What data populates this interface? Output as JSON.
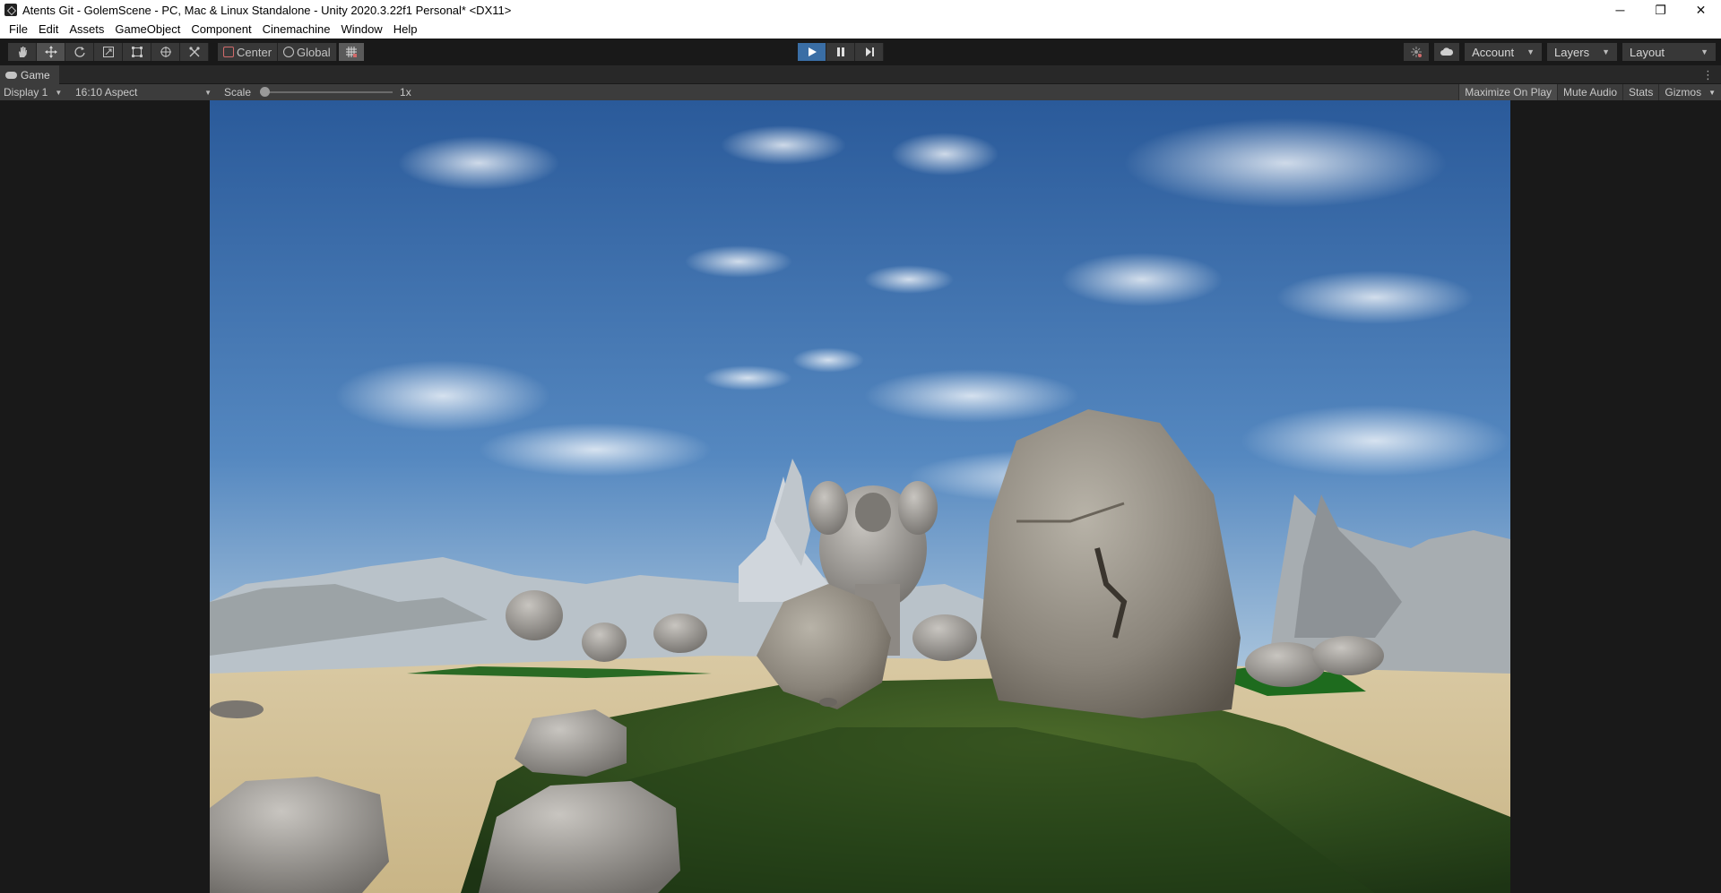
{
  "window": {
    "title": "Atents Git - GolemScene - PC, Mac & Linux Standalone - Unity 2020.3.22f1 Personal* <DX11>",
    "controls": [
      "─",
      "❐",
      "✕"
    ]
  },
  "menu": [
    "File",
    "Edit",
    "Assets",
    "GameObject",
    "Component",
    "Cinemachine",
    "Window",
    "Help"
  ],
  "toolbar": {
    "tools": [
      "hand-tool-icon",
      "move-tool-icon",
      "rotate-tool-icon",
      "scale-tool-icon",
      "rect-tool-icon",
      "transform-tool-icon",
      "custom-tool-icon"
    ],
    "active_tool": "move-tool-icon",
    "pivot_mode": "Center",
    "pivot_rotation": "Global",
    "play_active": true,
    "account_label": "Account",
    "layers_label": "Layers",
    "layout_label": "Layout"
  },
  "game_tab": {
    "label": "Game"
  },
  "game_bar": {
    "display": "Display 1",
    "aspect": "16:10 Aspect",
    "scale_label": "Scale",
    "scale_value": "1x",
    "scale_fraction": 0,
    "maximize_on_play": "Maximize On Play",
    "mute_audio": "Mute Audio",
    "stats": "Stats",
    "gizmos": "Gizmos"
  },
  "colors": {
    "play_accent": "#3a6ea5",
    "editor_bg": "#191919",
    "panel_bg": "#3c3c3c"
  }
}
